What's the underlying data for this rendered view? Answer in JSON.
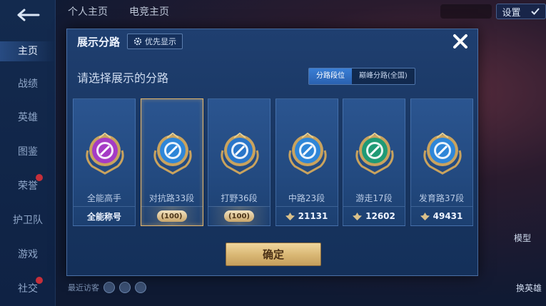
{
  "rail": {
    "items": [
      {
        "label": "主页",
        "active": true
      },
      {
        "label": "战绩"
      },
      {
        "label": "英雄"
      },
      {
        "label": "图鉴"
      },
      {
        "label": "荣誉"
      },
      {
        "label": "护卫队"
      },
      {
        "label": "游戏"
      },
      {
        "label": "社交"
      }
    ]
  },
  "top": {
    "tab1": "个人主页",
    "tab2": "电竞主页",
    "settings_label": "设置"
  },
  "bottom": {
    "recent_visitors": "最近访客"
  },
  "right_extra": {
    "model": "模型",
    "change_hero": "换英雄"
  },
  "modal": {
    "title": "展示分路",
    "priority_btn": "优先显示",
    "subtitle": "请选择展示的分路",
    "toggle": [
      "分路段位",
      "巅峰分路(全国)"
    ],
    "confirm": "确定",
    "cards": [
      {
        "name": "全能高手",
        "footer": "全能称号",
        "kind": "text",
        "color": "#a53bc5"
      },
      {
        "name": "对抗路33段",
        "footer": "100",
        "kind": "badge",
        "color": "#2e86d8",
        "selected": true
      },
      {
        "name": "打野36段",
        "footer": "100",
        "kind": "badge",
        "color": "#2a76c9"
      },
      {
        "name": "中路23段",
        "footer": "21131",
        "kind": "score",
        "color": "#2e86d8"
      },
      {
        "name": "游走17段",
        "footer": "12602",
        "kind": "score",
        "color": "#1f9a75"
      },
      {
        "name": "发育路37段",
        "footer": "49431",
        "kind": "score",
        "color": "#2e86d8"
      }
    ]
  },
  "colors": {
    "modal_bg": "#1f3f70",
    "gold": "#d8b673",
    "selected_border": "#e3b56a",
    "toggle_active": "#3a7fd6"
  }
}
